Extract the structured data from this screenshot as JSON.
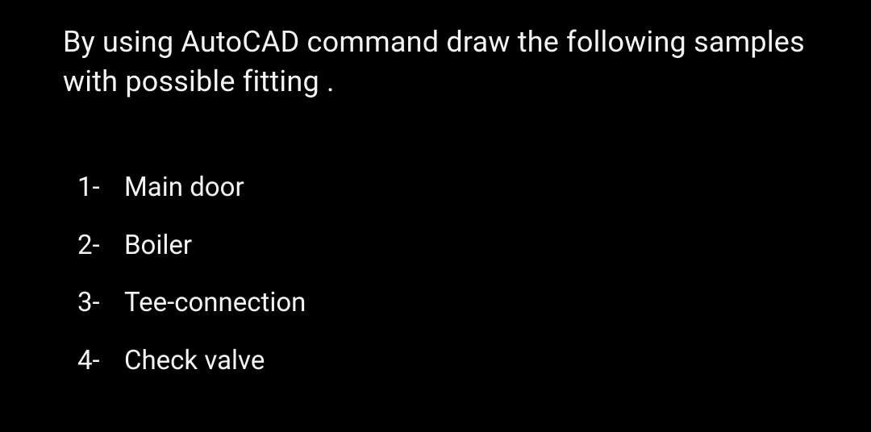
{
  "prompt": "By using AutoCAD command draw the following samples with possible fitting .",
  "items": [
    {
      "marker": "1-",
      "label": "Main door"
    },
    {
      "marker": "2-",
      "label": "Boiler"
    },
    {
      "marker": "3-",
      "label": "Tee-connection"
    },
    {
      "marker": "4-",
      "label": "Check valve"
    }
  ]
}
